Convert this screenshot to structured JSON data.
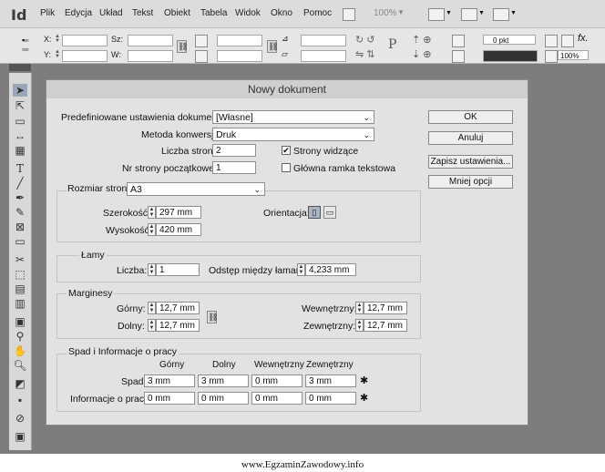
{
  "app": {
    "logo": "Id",
    "menu": [
      "Plik",
      "Edycja",
      "Układ",
      "Tekst",
      "Obiekt",
      "Tabela",
      "Widok",
      "Okno",
      "Pomoc"
    ],
    "zoom": "100%"
  },
  "control_panel": {
    "x_label": "X:",
    "y_label": "Y:",
    "w_label": "Sz:",
    "h_label": "W:",
    "stroke_weight": "0 pkt",
    "opacity": "100%"
  },
  "dialog": {
    "title": "Nowy dokument",
    "preset_label": "Predefiniowane ustawienia dokumentu:",
    "preset_value": "[Własne]",
    "intent_label": "Metoda konwersji:",
    "intent_value": "Druk",
    "pages_label": "Liczba stron:",
    "pages_value": "2",
    "start_page_label": "Nr strony początkowej:",
    "start_page_value": "1",
    "facing_pages_label": "Strony widzące",
    "facing_pages_checked": true,
    "master_frame_label": "Główna ramka tekstowa",
    "master_frame_checked": false,
    "page_size_label": "Rozmiar strony:",
    "page_size_value": "A3",
    "width_label": "Szerokość:",
    "width_value": "297 mm",
    "height_label": "Wysokość:",
    "height_value": "420 mm",
    "orientation_label": "Orientacja:",
    "columns_group": "Łamy",
    "columns_count_label": "Liczba:",
    "columns_count_value": "1",
    "gutter_label": "Odstęp między łamami:",
    "gutter_value": "4,233 mm",
    "margins_group": "Marginesy",
    "top_label": "Górny:",
    "top_value": "12,7 mm",
    "bottom_label": "Dolny:",
    "bottom_value": "12,7 mm",
    "inside_label": "Wewnętrzny:",
    "inside_value": "12,7 mm",
    "outside_label": "Zewnętrzny:",
    "outside_value": "12,7 mm",
    "bleed_group": "Spad i Informacje o pracy",
    "col_headers": [
      "Górny",
      "Dolny",
      "Wewnętrzny",
      "Zewnętrzny"
    ],
    "bleed_label": "Spad:",
    "bleed_values": [
      "3 mm",
      "3 mm",
      "0 mm",
      "3 mm"
    ],
    "slug_label": "Informacje o pracy:",
    "slug_values": [
      "0 mm",
      "0 mm",
      "0 mm",
      "0 mm"
    ],
    "buttons": {
      "ok": "OK",
      "cancel": "Anuluj",
      "save_preset": "Zapisz ustawienia...",
      "fewer_options": "Mniej opcji"
    }
  },
  "footer": "www.EgzaminZawodowy.info"
}
